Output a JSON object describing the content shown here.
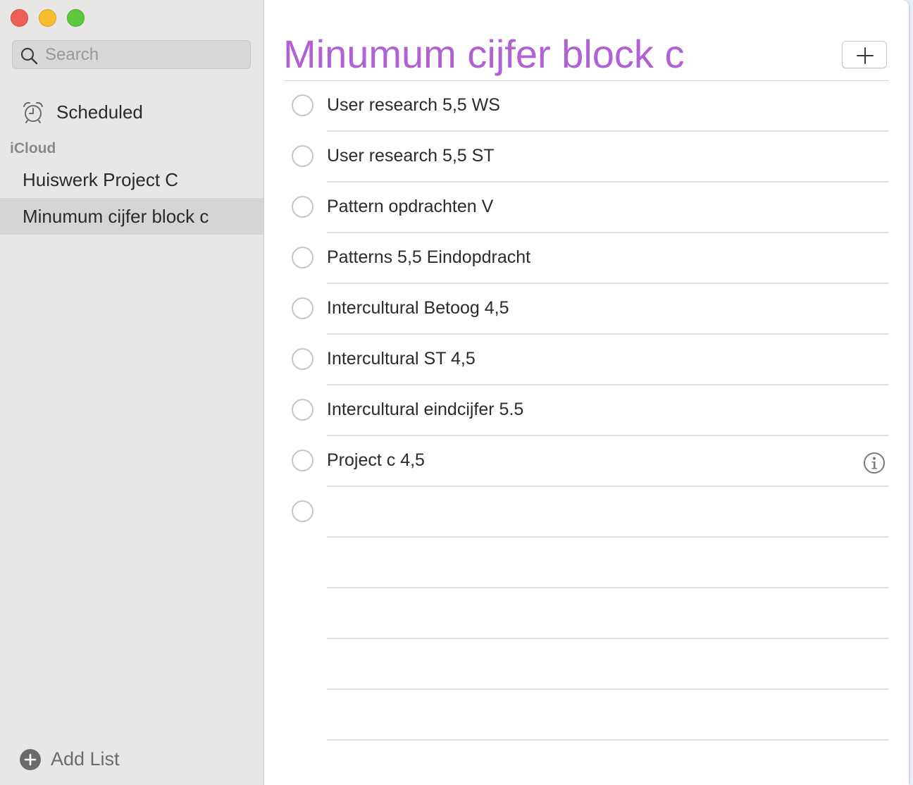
{
  "sidebar": {
    "search": {
      "placeholder": "Search",
      "value": ""
    },
    "smart_lists": [
      {
        "label": "Scheduled",
        "icon": "alarm-clock-icon"
      }
    ],
    "section_header": "iCloud",
    "lists": [
      {
        "label": "Huiswerk Project C",
        "selected": false
      },
      {
        "label": "Minumum cijfer block c",
        "selected": true
      }
    ],
    "add_list_label": "Add List"
  },
  "main": {
    "title": "Minumum cijfer block c",
    "title_color": "#b160d6",
    "add_button_icon": "plus-icon",
    "reminders": [
      {
        "text": "User research 5,5 WS",
        "completed": false
      },
      {
        "text": "User research 5,5 ST",
        "completed": false
      },
      {
        "text": "Pattern opdrachten V",
        "completed": false
      },
      {
        "text": "Patterns 5,5 Eindopdracht",
        "completed": false
      },
      {
        "text": "Intercultural Betoog 4,5",
        "completed": false
      },
      {
        "text": "Intercultural ST 4,5",
        "completed": false
      },
      {
        "text": "Intercultural eindcijfer 5.5",
        "completed": false
      },
      {
        "text": "Project c 4,5",
        "completed": false,
        "info_icon": "info-icon"
      },
      {
        "text": "",
        "completed": false
      }
    ]
  },
  "colors": {
    "close": "#ee5f58",
    "minimize": "#f8bd2f",
    "maximize": "#5fc73f",
    "sidebar_bg": "#e8e7e6",
    "selected_bg": "#d6d5d4"
  }
}
